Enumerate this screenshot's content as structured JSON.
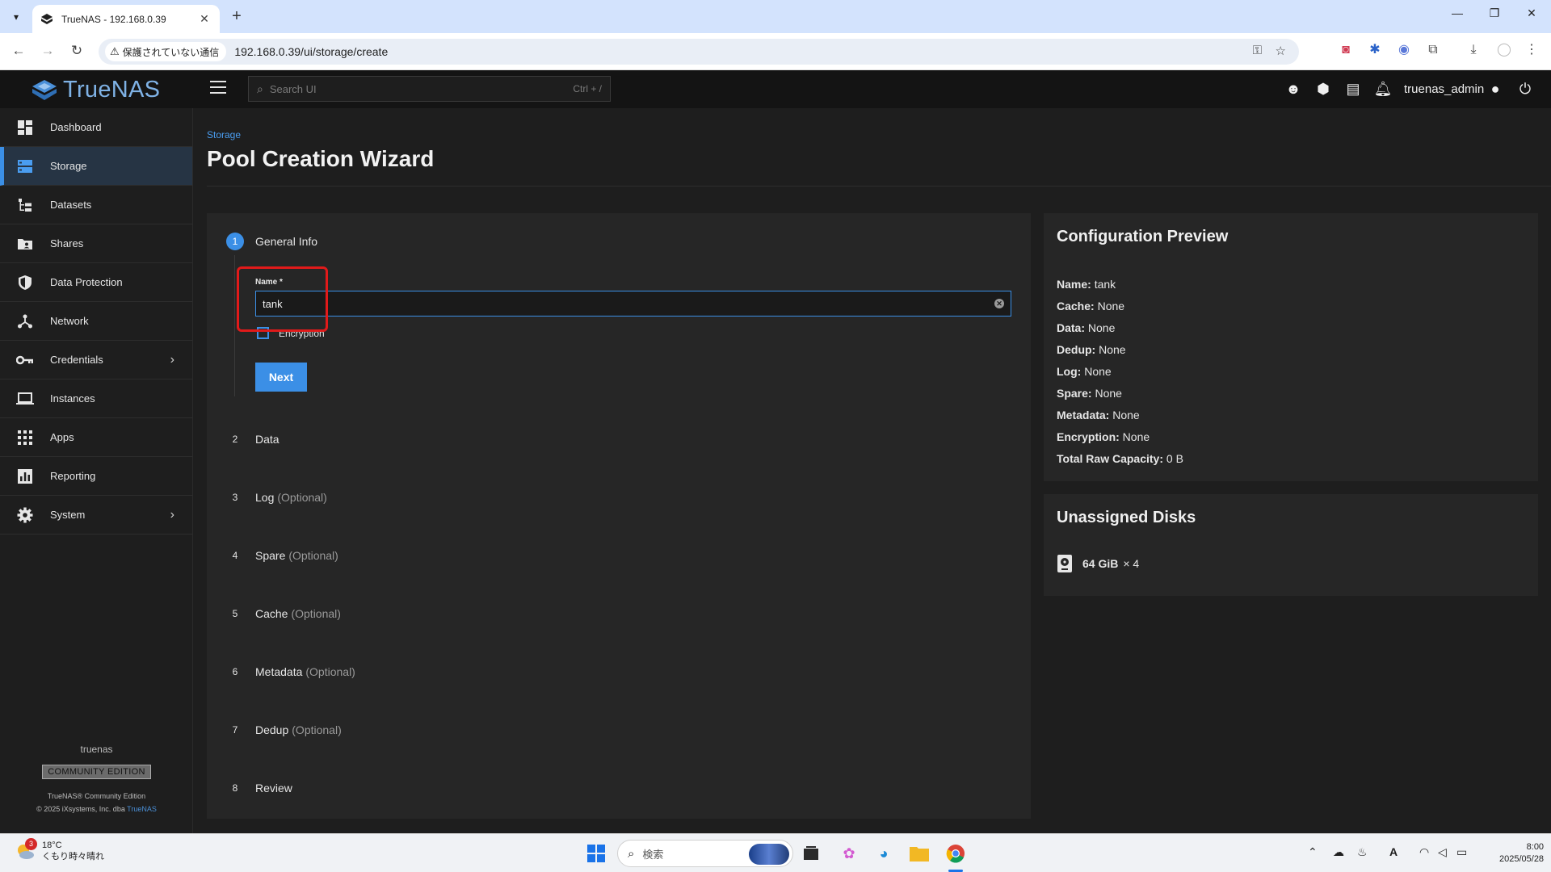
{
  "browser": {
    "tab_title": "TrueNAS - 192.168.0.39",
    "security_label": "保護されていない通信",
    "url": "192.168.0.39/ui/storage/create"
  },
  "app": {
    "logo_text": "TrueNAS",
    "search_placeholder": "Search UI",
    "search_shortcut": "Ctrl + /",
    "username": "truenas_admin",
    "accent_color": "#3b8fe6"
  },
  "sidebar": {
    "items": [
      {
        "label": "Dashboard",
        "icon": "dashboard-icon"
      },
      {
        "label": "Storage",
        "icon": "storage-icon",
        "active": true
      },
      {
        "label": "Datasets",
        "icon": "datasets-icon"
      },
      {
        "label": "Shares",
        "icon": "shares-icon"
      },
      {
        "label": "Data Protection",
        "icon": "shield-icon"
      },
      {
        "label": "Network",
        "icon": "network-icon"
      },
      {
        "label": "Credentials",
        "icon": "key-icon",
        "expandable": true
      },
      {
        "label": "Instances",
        "icon": "laptop-icon"
      },
      {
        "label": "Apps",
        "icon": "apps-grid-icon"
      },
      {
        "label": "Reporting",
        "icon": "bar-chart-icon"
      },
      {
        "label": "System",
        "icon": "gear-icon",
        "expandable": true
      }
    ],
    "footer": {
      "hostname": "truenas",
      "edition": "COMMUNITY EDITION",
      "product": "TrueNAS® Community Edition",
      "copyright": "© 2025 iXsystems, Inc. dba",
      "copyright_link": "TrueNAS"
    }
  },
  "page": {
    "breadcrumb": "Storage",
    "title": "Pool Creation Wizard"
  },
  "wizard": {
    "steps": [
      {
        "num": "1",
        "label": "General Info",
        "optional": ""
      },
      {
        "num": "2",
        "label": "Data",
        "optional": ""
      },
      {
        "num": "3",
        "label": "Log",
        "optional": "(Optional)"
      },
      {
        "num": "4",
        "label": "Spare",
        "optional": "(Optional)"
      },
      {
        "num": "5",
        "label": "Cache",
        "optional": "(Optional)"
      },
      {
        "num": "6",
        "label": "Metadata",
        "optional": "(Optional)"
      },
      {
        "num": "7",
        "label": "Dedup",
        "optional": "(Optional)"
      },
      {
        "num": "8",
        "label": "Review",
        "optional": ""
      }
    ],
    "name_label": "Name",
    "name_required_marker": "*",
    "name_value": "tank",
    "encryption_label": "Encryption",
    "encryption_checked": false,
    "next_label": "Next"
  },
  "config_preview": {
    "title": "Configuration Preview",
    "rows": [
      {
        "key": "Name:",
        "value": "tank"
      },
      {
        "key": "Cache:",
        "value": "None"
      },
      {
        "key": "Data:",
        "value": "None"
      },
      {
        "key": "Dedup:",
        "value": "None"
      },
      {
        "key": "Log:",
        "value": "None"
      },
      {
        "key": "Spare:",
        "value": "None"
      },
      {
        "key": "Metadata:",
        "value": "None"
      },
      {
        "key": "Encryption:",
        "value": "None"
      },
      {
        "key": "Total Raw Capacity:",
        "value": "0 B"
      }
    ]
  },
  "unassigned_disks": {
    "title": "Unassigned Disks",
    "size": "64 GiB",
    "count": "× 4"
  },
  "taskbar": {
    "badge_count": "3",
    "temperature": "18°C",
    "weather": "くもり時々晴れ",
    "search_placeholder": "検索",
    "time": "8:00",
    "date": "2025/05/28"
  }
}
